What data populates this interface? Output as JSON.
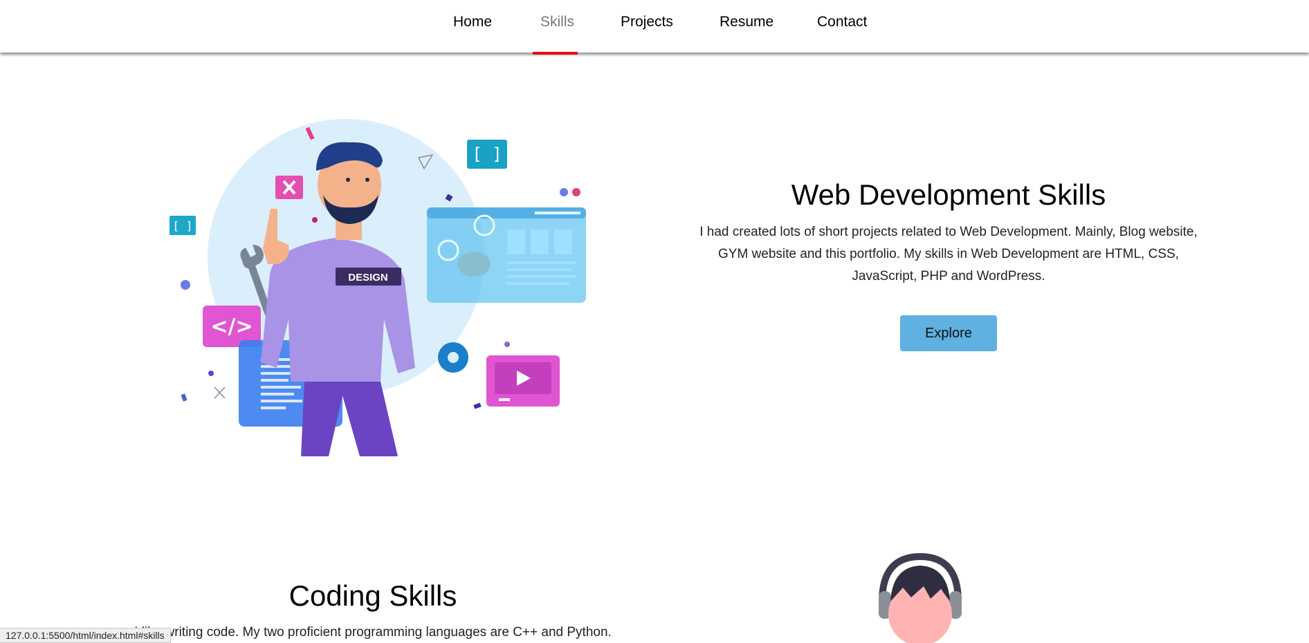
{
  "nav": {
    "items": [
      {
        "label": "Home"
      },
      {
        "label": "Skills"
      },
      {
        "label": "Projects"
      },
      {
        "label": "Resume"
      },
      {
        "label": "Contact"
      }
    ],
    "active": "Skills"
  },
  "web_section": {
    "title": "Web Development Skills",
    "description": "I had created lots of short projects related to Web Development. Mainly, Blog website, GYM website and this portfolio. My skills in Web Development are HTML, CSS, JavaScript, PHP and WordPress.",
    "button_label": "Explore",
    "illustration_badge": "DESIGN"
  },
  "coding_section": {
    "title": "Coding Skills",
    "description": "I like writing code. My two proficient programming languages are C++ and Python."
  },
  "status_bar": {
    "url": "127.0.0.1:5500/html/index.html#skills"
  },
  "colors": {
    "accent_underline": "#e10f0f",
    "button_bg": "#5eb1e0"
  }
}
